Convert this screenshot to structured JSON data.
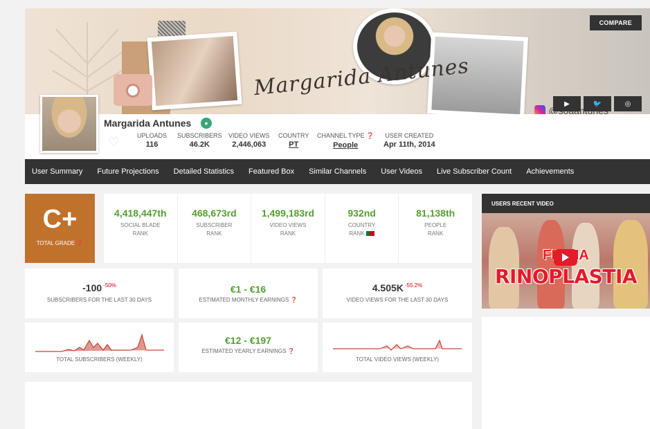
{
  "banner": {
    "signature": "Margarida Antunes",
    "compare_label": "COMPARE",
    "instagram_handle": "@soaantunes",
    "social_buttons": [
      "youtube-icon",
      "twitter-icon",
      "instagram-icon"
    ]
  },
  "channel": {
    "name": "Margarida Antunes",
    "stats": [
      {
        "label": "UPLOADS",
        "value": "116"
      },
      {
        "label": "SUBSCRIBERS",
        "value": "46.2K"
      },
      {
        "label": "VIDEO VIEWS",
        "value": "2,446,063"
      },
      {
        "label": "COUNTRY",
        "value": "PT"
      },
      {
        "label": "CHANNEL TYPE",
        "value": "People"
      },
      {
        "label": "USER CREATED",
        "value": "Apr 11th, 2014"
      }
    ]
  },
  "nav": {
    "items": [
      "User Summary",
      "Future Projections",
      "Detailed Statistics",
      "Featured Box",
      "Similar Channels",
      "User Videos",
      "Live Subscriber Count",
      "Achievements"
    ]
  },
  "grade": {
    "value": "C+",
    "label": "TOTAL GRADE"
  },
  "ranks": [
    {
      "value": "4,418,447th",
      "label1": "SOCIAL BLADE",
      "label2": "RANK"
    },
    {
      "value": "468,673rd",
      "label1": "SUBSCRIBER",
      "label2": "RANK"
    },
    {
      "value": "1,499,183rd",
      "label1": "VIDEO VIEWS",
      "label2": "RANK"
    },
    {
      "value": "932nd",
      "label1": "COUNTRY",
      "label2": "RANK"
    },
    {
      "value": "81,138th",
      "label1": "PEOPLE",
      "label2": "RANK"
    }
  ],
  "cards": {
    "subs30": {
      "value": "-100",
      "delta": "-50%",
      "label": "SUBSCRIBERS FOR THE LAST 30 DAYS"
    },
    "monthly": {
      "value": "€1 - €16",
      "label": "ESTIMATED MONTHLY EARNINGS"
    },
    "views30": {
      "value": "4.505K",
      "delta": "-55.2%",
      "label": "VIDEO VIEWS FOR THE LAST 30 DAYS"
    },
    "subs_weekly": {
      "label": "TOTAL SUBSCRIBERS (WEEKLY)"
    },
    "yearly": {
      "value": "€12 - €197",
      "label": "ESTIMATED YEARLY EARNINGS"
    },
    "views_weekly": {
      "label": "TOTAL VIDEO VIEWS (WEEKLY)"
    }
  },
  "sidebar": {
    "title": "USERS RECENT VIDEO",
    "video_text_top": "FIZ MA",
    "video_text_main": "RINOPLASTIA"
  },
  "colors": {
    "accent_green": "#52a030",
    "grade_orange": "#c0722d",
    "negative_red": "#d0021b",
    "nav_bg": "#333333"
  }
}
